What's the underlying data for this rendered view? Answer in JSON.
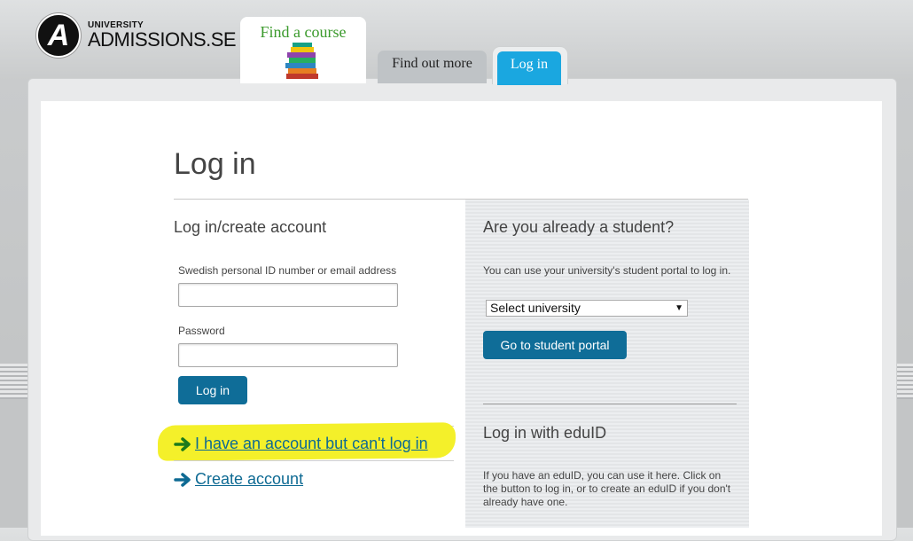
{
  "header": {
    "logo_small": "UNIVERSITY",
    "logo_big": "ADMISSIONS.SE",
    "tabs": {
      "find_course": "Find a course",
      "find_out_more": "Find out more",
      "log_in": "Log in"
    }
  },
  "page": {
    "title": "Log in"
  },
  "login_form": {
    "heading": "Log in/create account",
    "id_label": "Swedish personal ID number or email address",
    "id_value": "",
    "password_label": "Password",
    "password_value": "",
    "submit_label": "Log in",
    "cant_login_link": "I have an account but can't log in",
    "create_account_link": "Create account"
  },
  "student_panel": {
    "heading": "Are you already a student?",
    "text": "You can use your university's student portal to log in.",
    "select_value": "Select university",
    "portal_button": "Go to student portal",
    "eduid_heading": "Log in with eduID",
    "eduid_text": "If you have an eduID, you can use it here. Click on the button to log in, or to create an eduID if you don't already have one."
  },
  "colors": {
    "primary_button": "#0f6d98",
    "active_tab": "#1aa7e0",
    "find_course_text": "#3b9a2c",
    "highlight": "#f4f02a"
  }
}
